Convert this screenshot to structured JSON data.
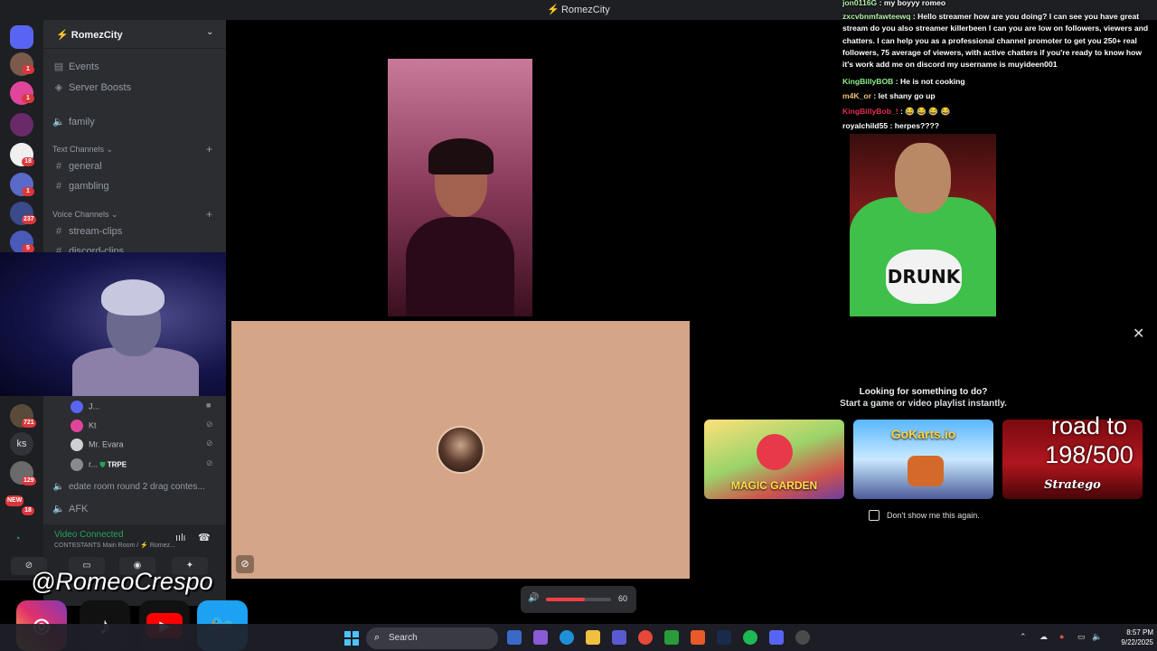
{
  "window": {
    "title": "RomezCity"
  },
  "server": {
    "name": "RomezCity"
  },
  "rail_badges": [
    {
      "label": "1"
    },
    {
      "label": "1"
    },
    {
      "label": "18"
    },
    {
      "label": "1"
    },
    {
      "label": "237"
    },
    {
      "label": "5"
    },
    {
      "label": "721"
    },
    {
      "label": "129"
    },
    {
      "label": "NEW"
    },
    {
      "label": "18"
    }
  ],
  "rail_text_server": "ks",
  "sidebar": {
    "top_items": [
      {
        "icon": "calendar-icon",
        "label": "Events"
      },
      {
        "icon": "boost-icon",
        "label": "Server Boosts"
      },
      {
        "icon": "speaker-icon",
        "label": "family"
      }
    ],
    "text_category": "Text Channels",
    "text_channels": [
      "general",
      "gambling"
    ],
    "voice_category": "Voice Channels",
    "voice_channels": [
      "stream-clips",
      "discord-clips"
    ],
    "voice_users": [
      {
        "name": "J...",
        "state": "camera-icon"
      },
      {
        "name": "Kt",
        "state": "deafened-icon"
      },
      {
        "name": "Mr. Evara",
        "state": "deafened-icon"
      },
      {
        "name": "r...",
        "tag": "TRPE",
        "state": "deafened-icon"
      }
    ],
    "lower_channels": [
      "edate room round 2 drag contes...",
      "AFK"
    ]
  },
  "voice_panel": {
    "status": "Video Connected",
    "subtitle": "CONTESTANTS Main Room / ⚡ Romez..."
  },
  "chat": [
    {
      "user": "jon0116G",
      "text": ": my boyyy romeo"
    },
    {
      "user": "zxcvbnmfawteewq",
      "text": ": Hello streamer how are you doing? I can see you have great stream do you also streamer killerbeen I can you are low on followers, viewers and chatters. I can help you as a professional channel promoter to get you 250+ real followers, 75 average of viewers, with active chatters if you're ready to know how it's work add me on discord my username is muyideen001"
    },
    {
      "user": "KingBillyBOB",
      "text": ": He is not cooking"
    },
    {
      "user": "m4K_or",
      "text": ": let shany go up"
    },
    {
      "user": "KingBillyBob_!",
      "text": ": 😂 😂 😂 😂"
    },
    {
      "user": "royalchild55",
      "text": ": herpes????"
    }
  ],
  "tile_guy_shirt": "DRUNK",
  "activity": {
    "heading": "Looking for something to do?",
    "subheading": "Start a game or video playlist instantly.",
    "cards": [
      {
        "label": "MAGIC GARDEN"
      },
      {
        "label": "GoKarts.io"
      },
      {
        "label": "Stratego"
      }
    ],
    "checkbox_label": "Don't show me this again."
  },
  "stream_overlay": {
    "goal_line1": "road to",
    "goal_line2": "198/500"
  },
  "volume": {
    "value": "60",
    "level": 0.6
  },
  "social": {
    "handle": "@RomeoCrespo",
    "icons": [
      "instagram-icon",
      "tiktok-icon",
      "youtube-icon",
      "twitter-icon"
    ]
  },
  "taskbar": {
    "search_placeholder": "Search",
    "time": "8:57 PM",
    "date": "9/22/2025"
  },
  "colors": {
    "discord_bg": "#2b2d31",
    "rail_bg": "#1e1f22",
    "connected_green": "#23a55a",
    "peach_tile": "#d4a587",
    "volume_fill": "#f23f43"
  }
}
